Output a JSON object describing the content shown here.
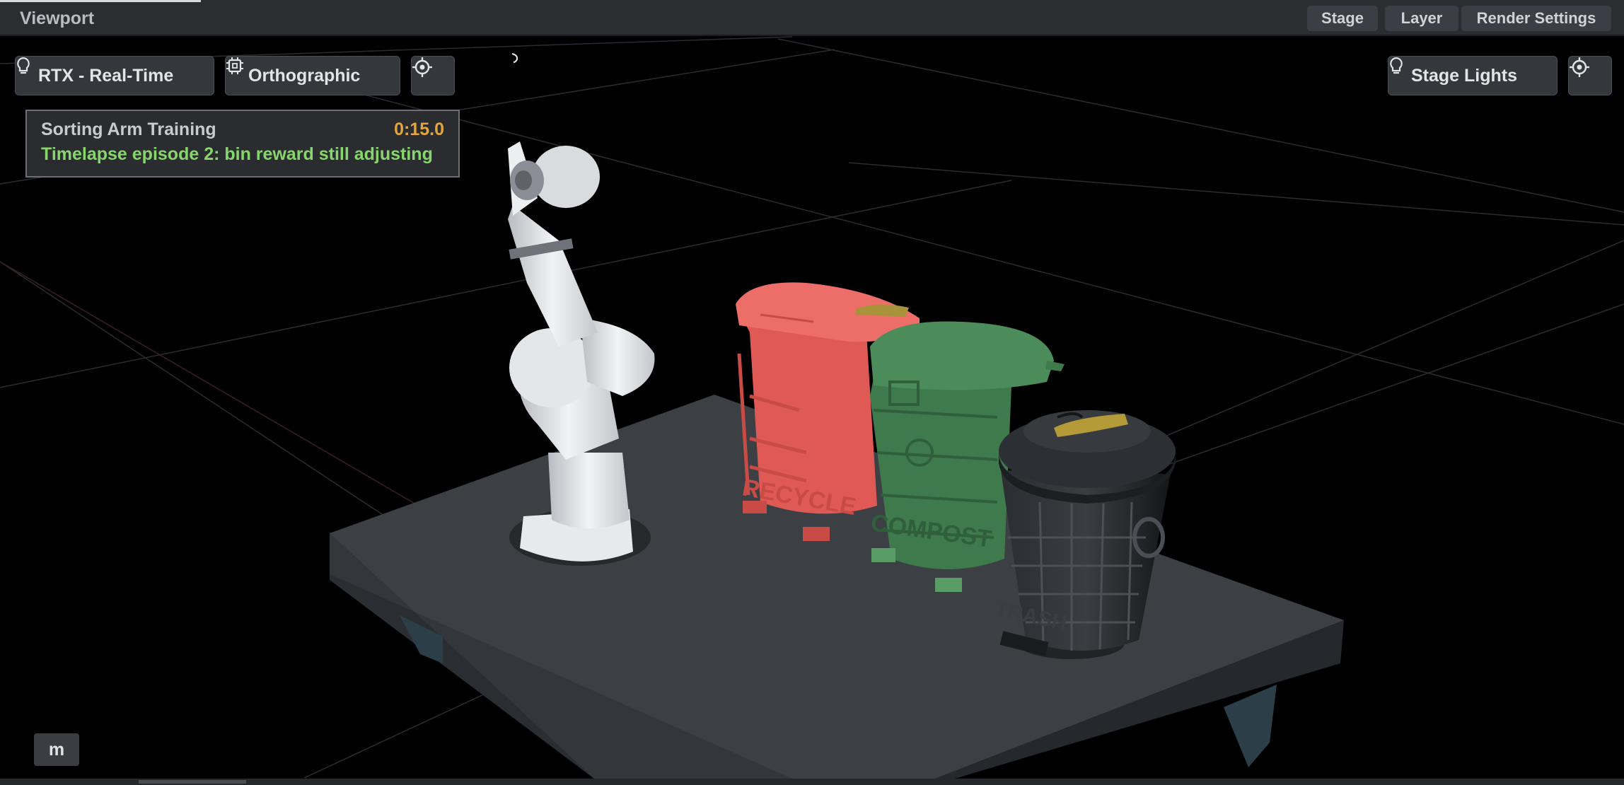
{
  "window": {
    "title": "Viewport",
    "menu": {
      "stage": "Stage",
      "layer": "Layer",
      "render_settings": "Render Settings"
    }
  },
  "toolbar": {
    "renderer": "RTX - Real-Time",
    "projection": "Orthographic",
    "stage_lights": "Stage Lights"
  },
  "info_panel": {
    "name": "Sorting Arm Training",
    "time": "0:15.0",
    "status": "Timelapse episode 2: bin reward still adjusting"
  },
  "bins": {
    "recycle_label": "RECYCLE",
    "compost_label": "COMPOST",
    "trash_label": "TRASH"
  },
  "bottom": {
    "m_label": "m"
  },
  "colors": {
    "time": "#e3a53c",
    "status": "#86d66b",
    "recycle": "#e05a55",
    "compost": "#3f7a4d",
    "trash": "#1f2124",
    "table": "#3c4045"
  },
  "icons": {
    "renderer": "lightbulb-icon",
    "projection": "chip-icon",
    "camera": "target-icon",
    "lights": "lightbulb-icon",
    "lights_camera": "target-icon"
  }
}
